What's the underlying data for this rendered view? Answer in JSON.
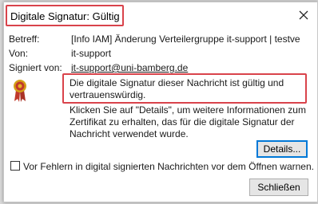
{
  "window": {
    "title": "Digitale Signatur: Gültig",
    "close_icon": "close-icon"
  },
  "header": {
    "subject_label": "Betreff:",
    "subject_value": "[Info IAM] Änderung Verteilergruppe it-support | testve",
    "from_label": "Von:",
    "from_value": "it-support",
    "signed_by_label": "Signiert von:",
    "signed_by_value": "it-support@uni-bamberg.de"
  },
  "status": {
    "icon": "ribbon-seal-icon",
    "main_message": "Die digitale Signatur dieser Nachricht ist gültig und vertrauenswürdig.",
    "detail_message": "Klicken Sie auf \"Details\", um weitere Informationen zum Zertifikat zu erhalten, das für die digitale Signatur der Nachricht verwendet wurde."
  },
  "buttons": {
    "details_label": "Details...",
    "close_label": "Schließen"
  },
  "options": {
    "warn_label": "Vor Fehlern in digital signierten Nachrichten vor dem Öffnen warnen.",
    "warn_checked": false
  },
  "colors": {
    "highlight": "#d9434b",
    "focus_border": "#0078d7",
    "ribbon_red": "#c0392b",
    "ribbon_gold": "#d4a017"
  }
}
